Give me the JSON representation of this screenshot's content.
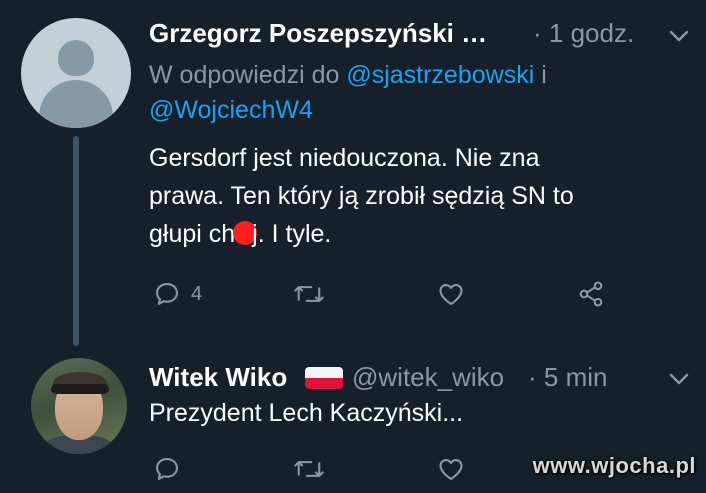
{
  "tweets": [
    {
      "author_name": "Grzegorz Poszepszyński …",
      "time": "· 1 godz.",
      "reply_prefix": "W odpowiedzi do ",
      "mention_1": "@sjastrzebowski",
      "reply_and": " i",
      "mention_2": "@WojciechW4",
      "text_1": "Gersdorf jest niedouczona. Nie zna",
      "text_2": "prawa. Ten który ją zrobił sędzią SN to",
      "text_3a": "głupi ch",
      "text_3b": "j. I tyle.",
      "reply_count": "4"
    },
    {
      "author_name": "Witek Wiko",
      "handle": "@witek_wiko",
      "time": "· 5 min",
      "text": "Prezydent Lech Kaczyński..."
    }
  ],
  "watermark": "www.wjocha.pl",
  "colors": {
    "background": "#15202b",
    "secondary_text": "#8899a6",
    "link": "#1da1f2",
    "redaction": "#ff1e1e"
  }
}
